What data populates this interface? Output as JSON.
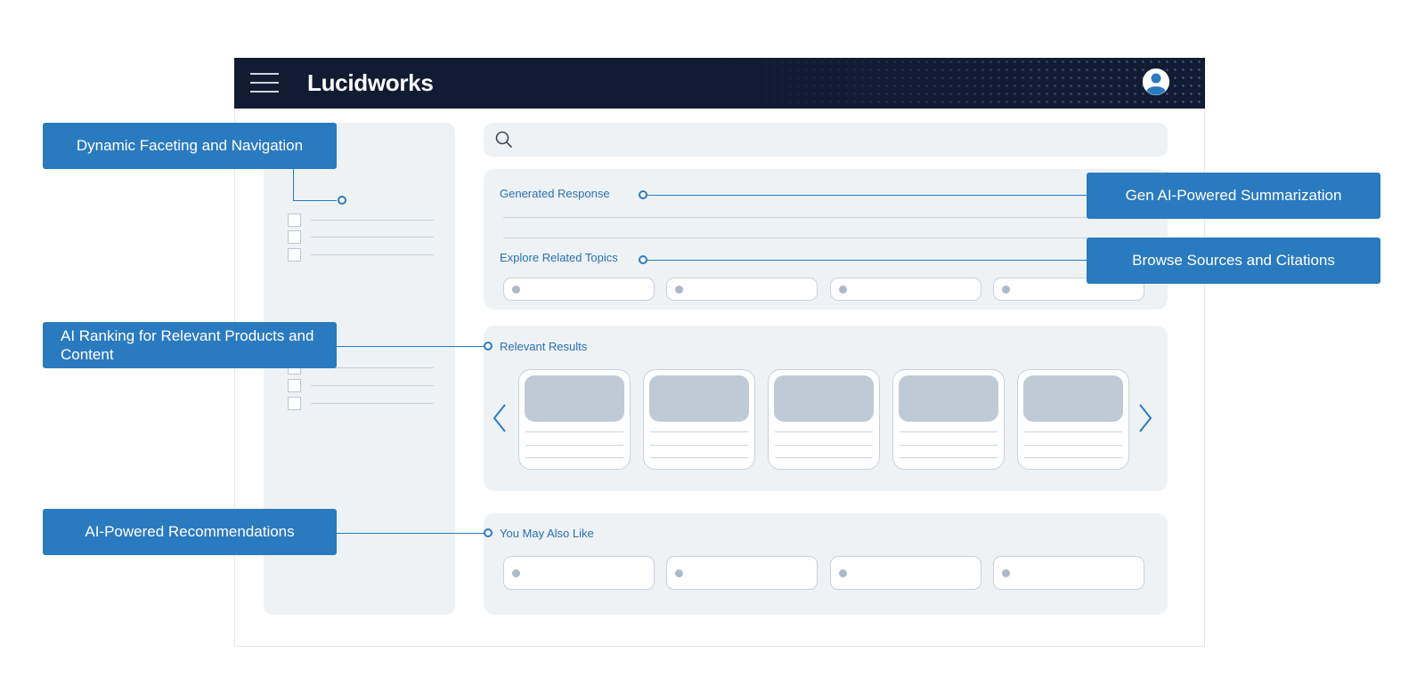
{
  "header": {
    "brand": "Lucidworks",
    "menu_icon": "hamburger-menu-icon",
    "user_icon": "user-avatar-icon"
  },
  "search": {
    "icon": "search-icon",
    "placeholder": ""
  },
  "generated_panel": {
    "generated_response_label": "Generated Response",
    "explore_related_topics_label": "Explore Related Topics"
  },
  "results_panel": {
    "label": "Relevant Results",
    "prev_icon": "chevron-left-icon",
    "next_icon": "chevron-right-icon"
  },
  "recommendations_panel": {
    "label": "You May Also Like"
  },
  "callouts": {
    "faceting": "Dynamic Faceting and Navigation",
    "summarization": "Gen AI-Powered Summarization",
    "citations": "Browse Sources and Citations",
    "ranking": "AI Ranking for Relevant Products and Content",
    "recommendations": "AI-Powered Recommendations"
  },
  "colors": {
    "header_bg": "#111c33",
    "accent": "#2a7ac0",
    "panel_bg": "#eef2f5",
    "placeholder": "#c0cad5"
  }
}
